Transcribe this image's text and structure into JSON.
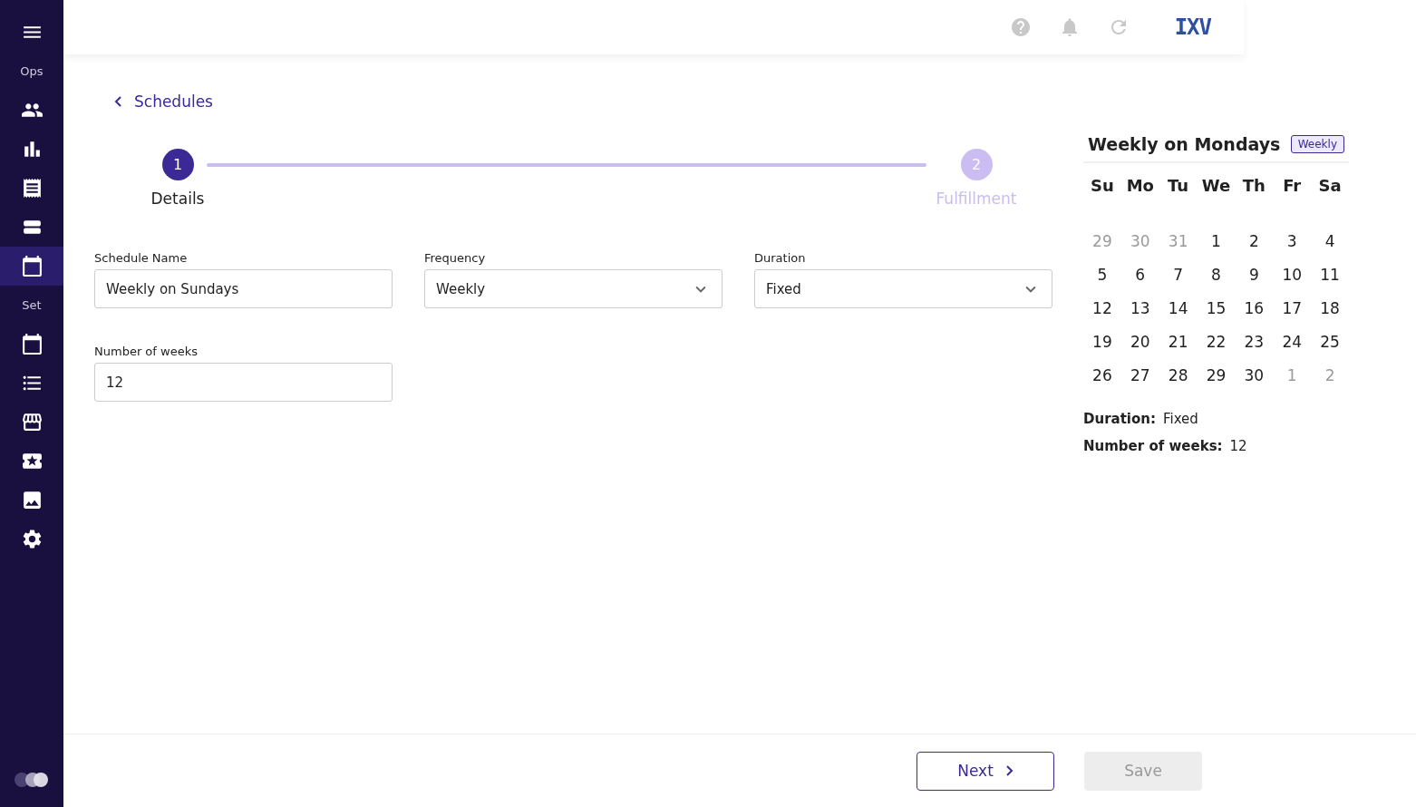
{
  "sidebar": {
    "items": [
      {
        "kind": "label",
        "text": "Ops"
      },
      {
        "kind": "icon",
        "selected": false
      },
      {
        "kind": "icon",
        "selected": false
      },
      {
        "kind": "icon",
        "selected": false
      },
      {
        "kind": "icon",
        "selected": false
      },
      {
        "kind": "icon",
        "selected": true
      },
      {
        "kind": "label",
        "text": "Set"
      },
      {
        "kind": "icon",
        "selected": false
      },
      {
        "kind": "icon",
        "selected": false
      },
      {
        "kind": "icon",
        "selected": false
      },
      {
        "kind": "icon",
        "selected": false
      },
      {
        "kind": "icon",
        "selected": false
      },
      {
        "kind": "icon",
        "selected": false
      }
    ]
  },
  "topbar": {
    "logo": "IXV"
  },
  "back_link": "Schedules",
  "steps": [
    {
      "number": "1",
      "label": "Details",
      "selected": true
    },
    {
      "number": "2",
      "label": "Fulfillment",
      "selected": false
    }
  ],
  "form": {
    "fields": [
      {
        "label": "Schedule Name",
        "kind": "text",
        "value": "Weekly on Sundays"
      },
      {
        "label": "Frequency",
        "kind": "select",
        "value": "Weekly"
      },
      {
        "label": "Duration",
        "kind": "select",
        "value": "Fixed"
      },
      {
        "label": "Number of weeks",
        "kind": "text",
        "value": "12"
      }
    ]
  },
  "summary": {
    "title": "Weekly on Mondays",
    "badge": "Weekly",
    "weekdays": [
      "Su",
      "Mo",
      "Tu",
      "We",
      "Th",
      "Fr",
      "Sa"
    ],
    "days": [
      {
        "text": "29",
        "dimmed": true
      },
      {
        "text": "30",
        "dimmed": true
      },
      {
        "text": "31",
        "dimmed": true
      },
      {
        "text": "1",
        "dimmed": false
      },
      {
        "text": "2",
        "dimmed": false
      },
      {
        "text": "3",
        "dimmed": false
      },
      {
        "text": "4",
        "dimmed": false
      },
      {
        "text": "5",
        "dimmed": false
      },
      {
        "text": "6",
        "dimmed": false
      },
      {
        "text": "7",
        "dimmed": false
      },
      {
        "text": "8",
        "dimmed": false
      },
      {
        "text": "9",
        "dimmed": false
      },
      {
        "text": "10",
        "dimmed": false
      },
      {
        "text": "11",
        "dimmed": false
      },
      {
        "text": "12",
        "dimmed": false
      },
      {
        "text": "13",
        "dimmed": false
      },
      {
        "text": "14",
        "dimmed": false
      },
      {
        "text": "15",
        "dimmed": false
      },
      {
        "text": "16",
        "dimmed": false
      },
      {
        "text": "17",
        "dimmed": false
      },
      {
        "text": "18",
        "dimmed": false
      },
      {
        "text": "19",
        "dimmed": false
      },
      {
        "text": "20",
        "dimmed": false
      },
      {
        "text": "21",
        "dimmed": false
      },
      {
        "text": "22",
        "dimmed": false
      },
      {
        "text": "23",
        "dimmed": false
      },
      {
        "text": "24",
        "dimmed": false
      },
      {
        "text": "25",
        "dimmed": false
      },
      {
        "text": "26",
        "dimmed": false
      },
      {
        "text": "27",
        "dimmed": false
      },
      {
        "text": "28",
        "dimmed": false
      },
      {
        "text": "29",
        "dimmed": false
      },
      {
        "text": "30",
        "dimmed": false
      },
      {
        "text": "1",
        "dimmed": true
      },
      {
        "text": "2",
        "dimmed": true
      }
    ],
    "details": [
      {
        "label": "Duration:",
        "value": "Fixed"
      },
      {
        "label": "Number of weeks:",
        "value": "12"
      }
    ]
  },
  "footer": {
    "buttons": [
      {
        "label": "Next",
        "kind": "primary",
        "disabled": false
      },
      {
        "label": "Save",
        "kind": "save",
        "disabled": true
      }
    ]
  }
}
